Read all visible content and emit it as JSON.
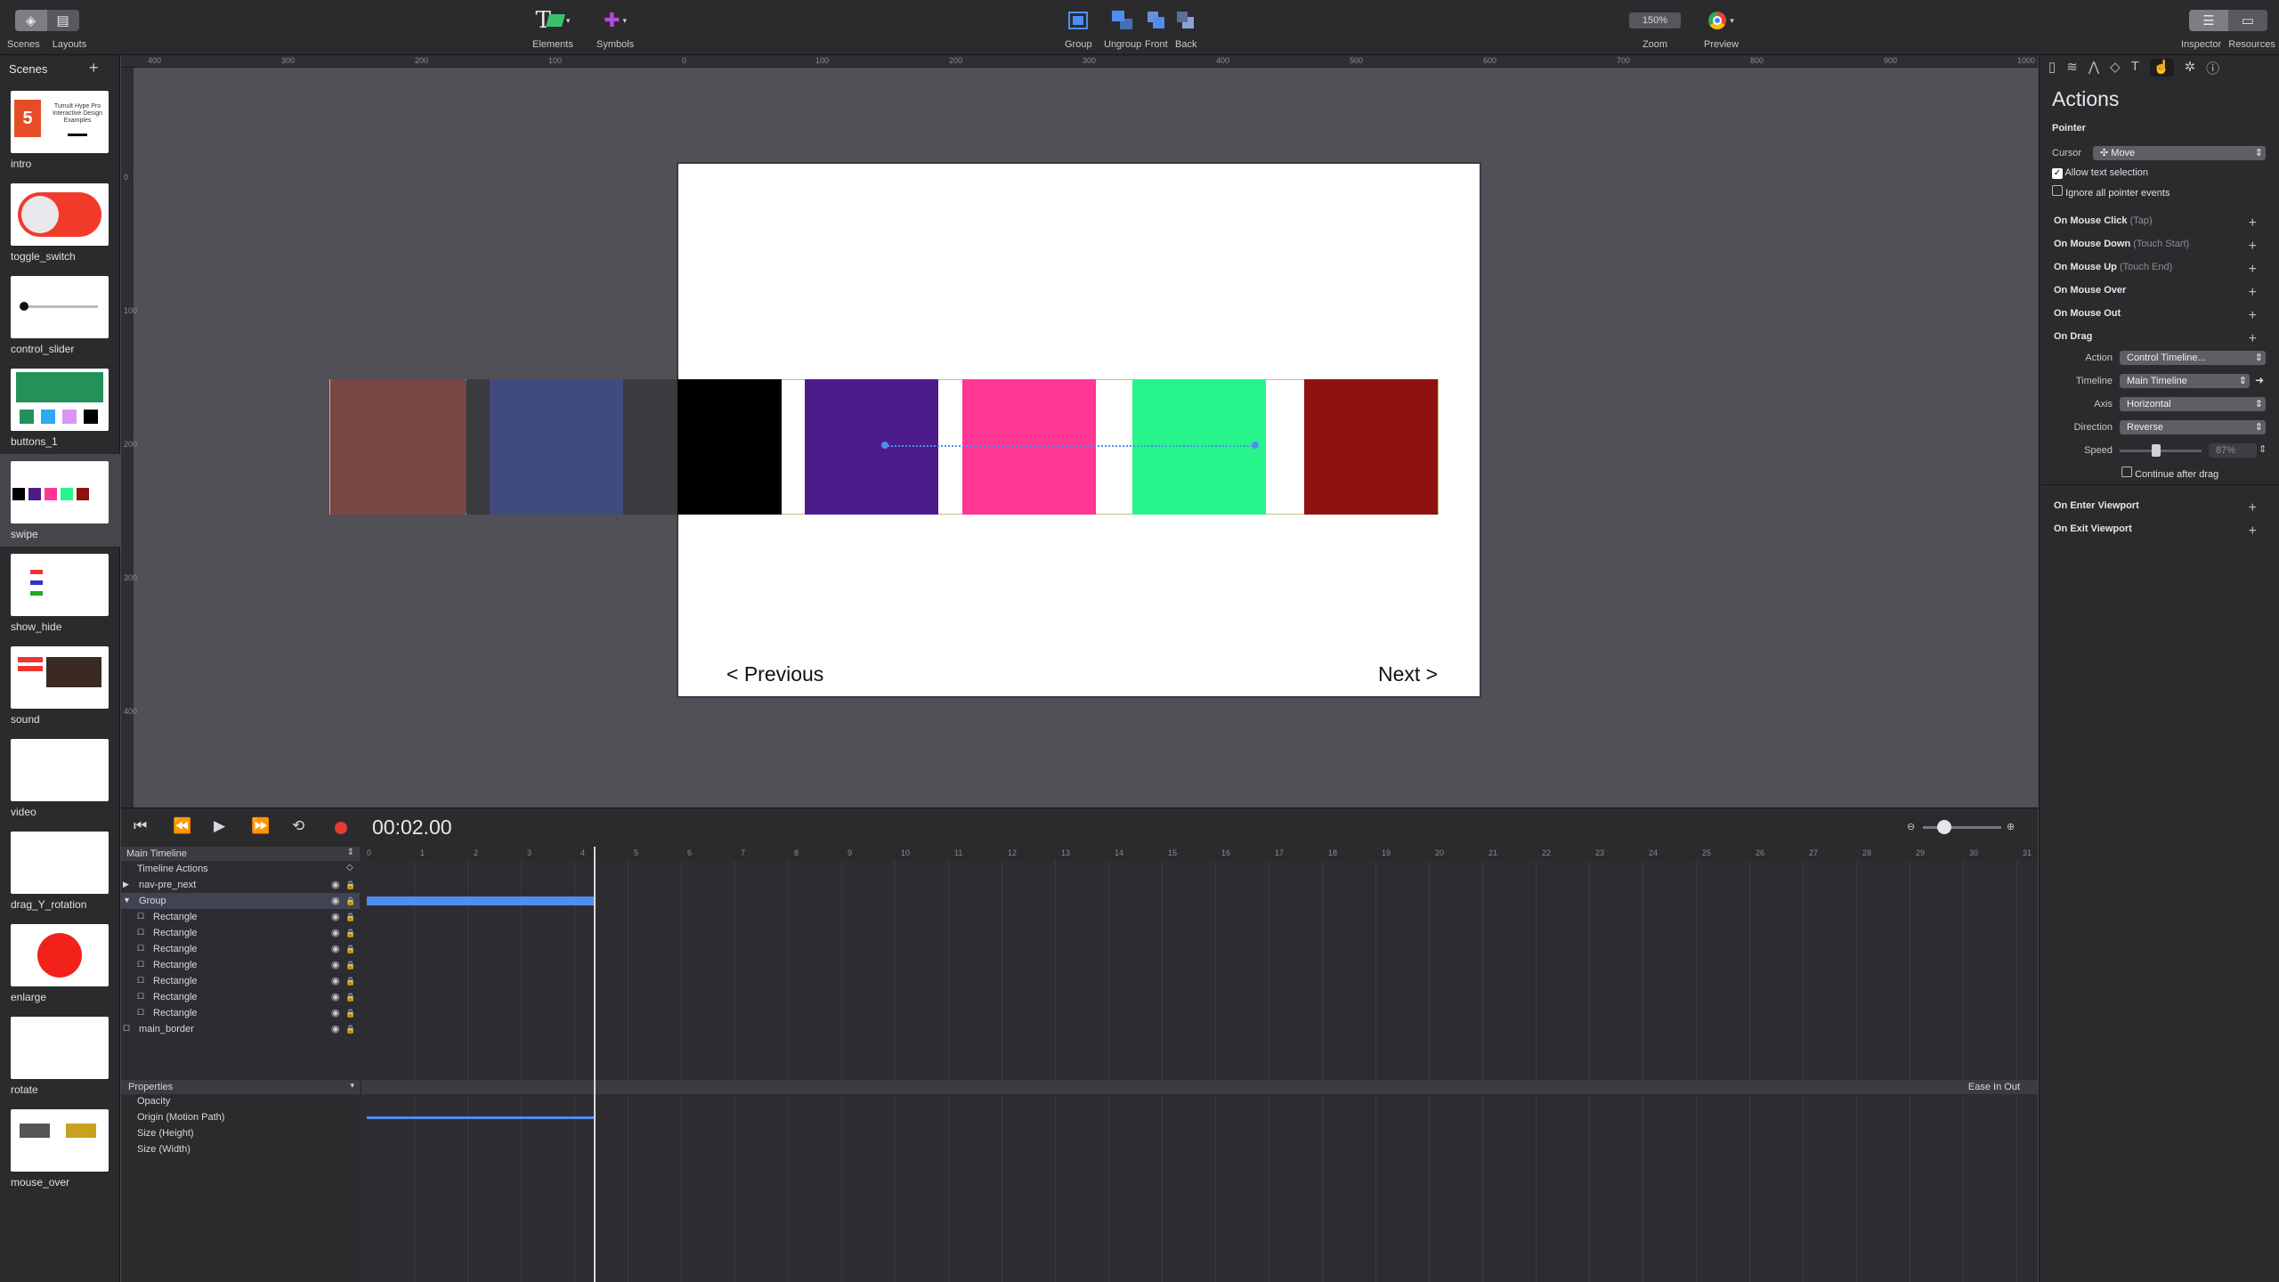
{
  "toolbar": {
    "scenes": "Scenes",
    "layouts": "Layouts",
    "elements": "Elements",
    "symbols": "Symbols",
    "group": "Group",
    "ungroup": "Ungroup",
    "front": "Front",
    "back": "Back",
    "zoom_value": "150%",
    "zoom": "Zoom",
    "preview": "Preview",
    "inspector": "Inspector",
    "resources": "Resources"
  },
  "sidebar": {
    "title": "Scenes",
    "add": "+",
    "scenes": [
      {
        "label": "intro",
        "thumb_text": "Tumult Hype Pro Interactive Design Examples"
      },
      {
        "label": "toggle_switch"
      },
      {
        "label": "control_slider"
      },
      {
        "label": "buttons_1"
      },
      {
        "label": "swipe"
      },
      {
        "label": "show_hide"
      },
      {
        "label": "sound"
      },
      {
        "label": "video"
      },
      {
        "label": "drag_Y_rotation"
      },
      {
        "label": "enlarge"
      },
      {
        "label": "rotate"
      },
      {
        "label": "mouse_over"
      }
    ]
  },
  "ruler": {
    "h": [
      "400",
      "300",
      "200",
      "100",
      "0",
      "100",
      "200",
      "300",
      "400",
      "500",
      "600",
      "700",
      "800",
      "900",
      "1000"
    ],
    "v": [
      "0",
      "100",
      "200",
      "300",
      "400"
    ]
  },
  "stage": {
    "prev": "< Previous",
    "next": "Next >",
    "squares": [
      "#7b4646",
      "#414a7e",
      "#000000",
      "#4c1d8a",
      "#ff3693",
      "#27f58b",
      "#8e1210"
    ]
  },
  "inspector": {
    "title": "Actions",
    "pointer": "Pointer",
    "cursor_label": "Cursor",
    "cursor_value": "Move",
    "allow_text": "Allow text selection",
    "ignore_pointer": "Ignore all pointer events",
    "events": [
      {
        "name": "On Mouse Click",
        "sub": "(Tap)"
      },
      {
        "name": "On Mouse Down",
        "sub": "(Touch Start)"
      },
      {
        "name": "On Mouse Up",
        "sub": "(Touch End)"
      },
      {
        "name": "On Mouse Over",
        "sub": ""
      },
      {
        "name": "On Mouse Out",
        "sub": ""
      },
      {
        "name": "On Drag",
        "sub": ""
      }
    ],
    "drag": {
      "action_label": "Action",
      "action": "Control Timeline...",
      "timeline_label": "Timeline",
      "timeline": "Main Timeline",
      "axis_label": "Axis",
      "axis": "Horizontal",
      "direction_label": "Direction",
      "direction": "Reverse",
      "speed_label": "Speed",
      "speed": "87%",
      "continue": "Continue after drag"
    },
    "viewport": [
      {
        "name": "On Enter Viewport"
      },
      {
        "name": "On Exit Viewport"
      }
    ]
  },
  "timeline": {
    "time": "00:02.00",
    "main": "Main Timeline",
    "actions": "Timeline Actions",
    "layers": [
      {
        "name": "nav-pre_next"
      },
      {
        "name": "Group"
      },
      {
        "name": "Rectangle"
      },
      {
        "name": "Rectangle"
      },
      {
        "name": "Rectangle"
      },
      {
        "name": "Rectangle"
      },
      {
        "name": "Rectangle"
      },
      {
        "name": "Rectangle"
      },
      {
        "name": "Rectangle"
      },
      {
        "name": "main_border"
      }
    ],
    "properties": "Properties",
    "ease": "Ease In Out",
    "props": [
      {
        "name": "Opacity"
      },
      {
        "name": "Origin (Motion Path)"
      },
      {
        "name": "Size (Height)"
      },
      {
        "name": "Size (Width)"
      }
    ],
    "ticks": [
      "0",
      "1",
      "2",
      "3",
      "4",
      "5",
      "6",
      "7",
      "8",
      "9",
      "10",
      "11",
      "12",
      "13",
      "14",
      "15",
      "16",
      "17",
      "18",
      "19",
      "20",
      "21",
      "22",
      "23",
      "24",
      "25",
      "26",
      "27",
      "28",
      "29",
      "30",
      "31"
    ]
  }
}
